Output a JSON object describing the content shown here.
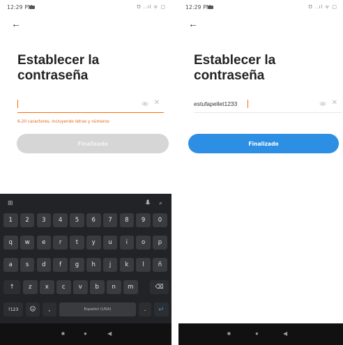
{
  "left": {
    "status": {
      "time": "12:29 PM",
      "right": "℧ ..ıl ᯤ ▢"
    },
    "title_line1": "Establecer la",
    "title_line2": "contraseña",
    "input_value": "",
    "hint": "6-20 caracteres, incluyendo letras y números",
    "button_label": "Finalizado",
    "keyboard": {
      "top_left_icon": "grid-icon",
      "row1": [
        "1",
        "2",
        "3",
        "4",
        "5",
        "6",
        "7",
        "8",
        "9",
        "0"
      ],
      "row2": [
        "q",
        "w",
        "e",
        "r",
        "t",
        "y",
        "u",
        "i",
        "o",
        "p"
      ],
      "row3": [
        "a",
        "s",
        "d",
        "f",
        "g",
        "h",
        "j",
        "k",
        "l",
        "ñ"
      ],
      "row4": [
        "↑",
        "z",
        "x",
        "c",
        "v",
        "b",
        "n",
        "m",
        "⌫"
      ],
      "row5_symbols": "?123",
      "row5_emoji": "☺",
      "row5_comma": ",",
      "row5_space": "Español (USA)",
      "row5_period": ".",
      "row5_enter": "↵"
    }
  },
  "right": {
    "status": {
      "time": "12:29 PM",
      "right": "℧ ..ıl ᯤ ▢"
    },
    "title_line1": "Establecer la",
    "title_line2": "contraseña",
    "input_value": "estufapellet1233",
    "button_label": "Finalizado"
  },
  "colors": {
    "accent_orange": "#ff6a00",
    "hint_orange": "#e2681e",
    "button_blue": "#2d8fe3",
    "button_disabled": "#d6d6d6",
    "keyboard_bg": "#222326"
  }
}
